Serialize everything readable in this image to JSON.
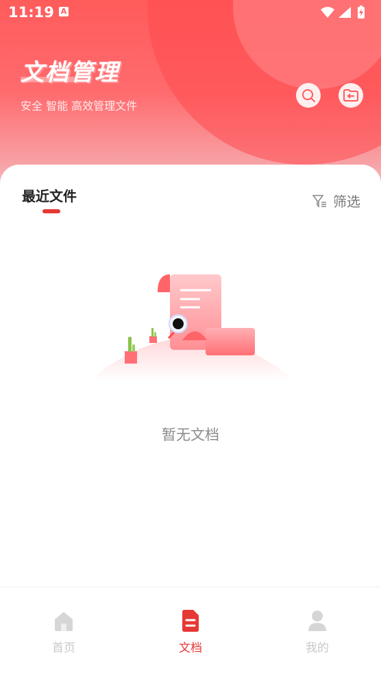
{
  "status_bar": {
    "time": "11:19",
    "notification_letter": "A"
  },
  "header": {
    "title": "文档管理",
    "subtitle": "安全 智能 高效管理文件"
  },
  "content": {
    "section_title": "最近文件",
    "filter_label": "筛选",
    "empty_text": "暂无文档"
  },
  "tabbar": {
    "items": [
      {
        "label": "首页",
        "icon": "home-icon",
        "active": false
      },
      {
        "label": "文档",
        "icon": "document-icon",
        "active": true
      },
      {
        "label": "我的",
        "icon": "person-icon",
        "active": false
      }
    ]
  },
  "colors": {
    "accent": "#e53935",
    "header_top": "#ff5b5b",
    "inactive": "#c8c8c8"
  }
}
